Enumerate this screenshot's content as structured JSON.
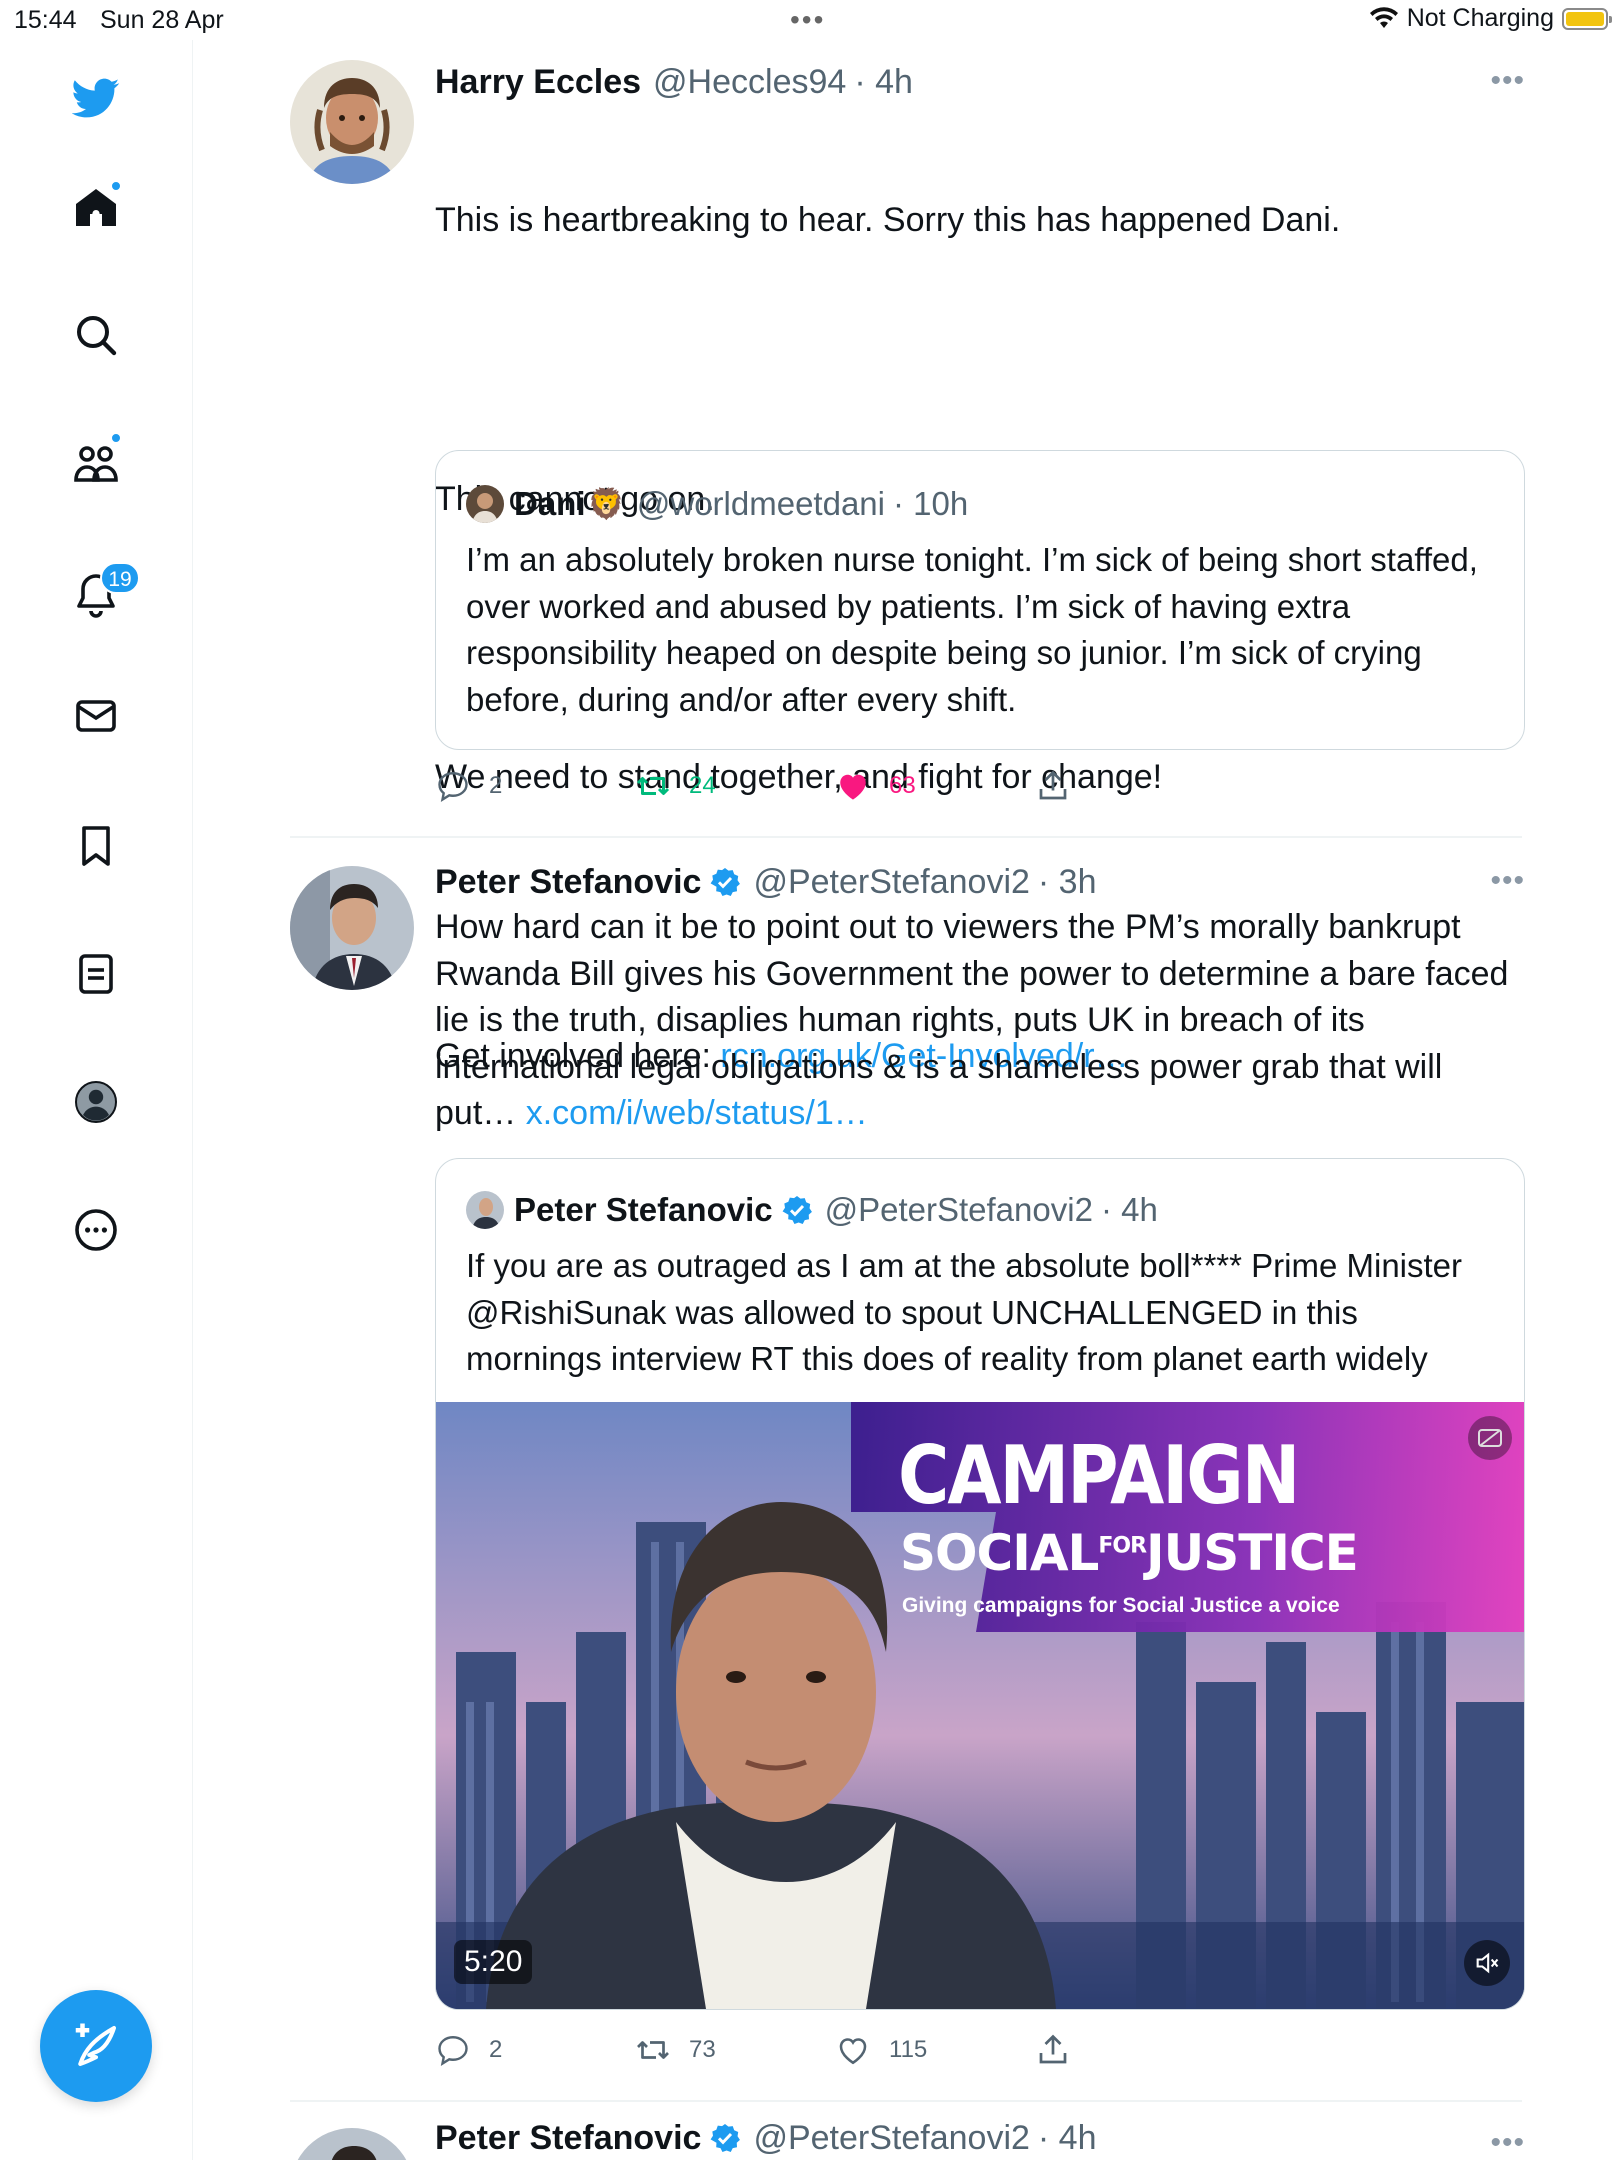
{
  "status_bar": {
    "time": "15:44",
    "date": "Sun 28 Apr",
    "battery_status": "Not Charging",
    "battery_color": "#f2c40f"
  },
  "sidebar": {
    "items": [
      {
        "name": "twitter-logo",
        "icon": "bird-icon"
      },
      {
        "name": "home",
        "icon": "home-icon",
        "has_dot": true
      },
      {
        "name": "explore",
        "icon": "search-icon"
      },
      {
        "name": "communities",
        "icon": "people-icon",
        "has_dot": true
      },
      {
        "name": "notifications",
        "icon": "bell-icon",
        "badge": "19"
      },
      {
        "name": "messages",
        "icon": "envelope-icon"
      },
      {
        "name": "bookmarks",
        "icon": "bookmark-icon"
      },
      {
        "name": "lists",
        "icon": "list-icon"
      },
      {
        "name": "profile",
        "icon": "profile-icon"
      },
      {
        "name": "more",
        "icon": "ellipsis-circle-icon"
      }
    ],
    "compose_icon": "compose-tweet-icon",
    "accent_color": "#1d9bf0"
  },
  "tweets": [
    {
      "name": "Harry Eccles",
      "handle": "@Heccles94",
      "time": "· 4h",
      "text_lines": [
        "This is heartbreaking to hear. Sorry this has happened Dani.",
        "This cannot go on.",
        "We need to stand together, and fight for change!"
      ],
      "link_prefix": "Get involved here: ",
      "link": "rcn.org.uk/Get-Involved/r…",
      "quote": {
        "name": "Dani",
        "emoji": "🦁",
        "handle": "@worldmeetdani",
        "time": "· 10h",
        "text": "I’m an absolutely broken nurse tonight. I’m sick of being short staffed, over worked and abused by patients. I’m sick of having extra responsibility heaped on despite being so junior. I’m sick of crying before, during and/or after every shift."
      },
      "replies": "2",
      "retweets": "24",
      "likes": "63",
      "liked": true,
      "retweeted_color": "#00ba7c",
      "liked_color": "#f91880"
    },
    {
      "name": "Peter Stefanovic",
      "handle": "@PeterStefanovi2",
      "time": "· 3h",
      "verified": true,
      "text": "How hard can it be to point out to viewers the PM’s morally bankrupt Rwanda Bill gives his Government the power to determine a bare faced lie is the truth, disaplies human rights, puts UK in breach of its international legal obligations & is a shameless power grab that will put… ",
      "link": "x.com/i/web/status/1…",
      "quote": {
        "name": "Peter Stefanovic",
        "handle": "@PeterStefanovi2",
        "time": "· 4h",
        "verified": true,
        "text": "If you are as outraged as I am at the absolute boll**** Prime Minister @RishiSunak was allowed to spout UNCHALLENGED in this mornings interview RT this does of reality from planet earth widely"
      },
      "video": {
        "banner_title": "CAMPAIGN",
        "banner_line2a": "SOCIAL",
        "banner_for": "FOR",
        "banner_line2b": "JUSTICE",
        "banner_tagline": "Giving campaigns for Social Justice a voice",
        "duration": "5:20",
        "mute_icon": "speaker-muted-icon",
        "captions_icon": "captions-icon"
      },
      "replies": "2",
      "retweets": "73",
      "likes": "115",
      "liked": false
    },
    {
      "name": "Peter Stefanovic",
      "handle": "@PeterStefanovi2",
      "time": "· 4h",
      "verified": true
    }
  ]
}
